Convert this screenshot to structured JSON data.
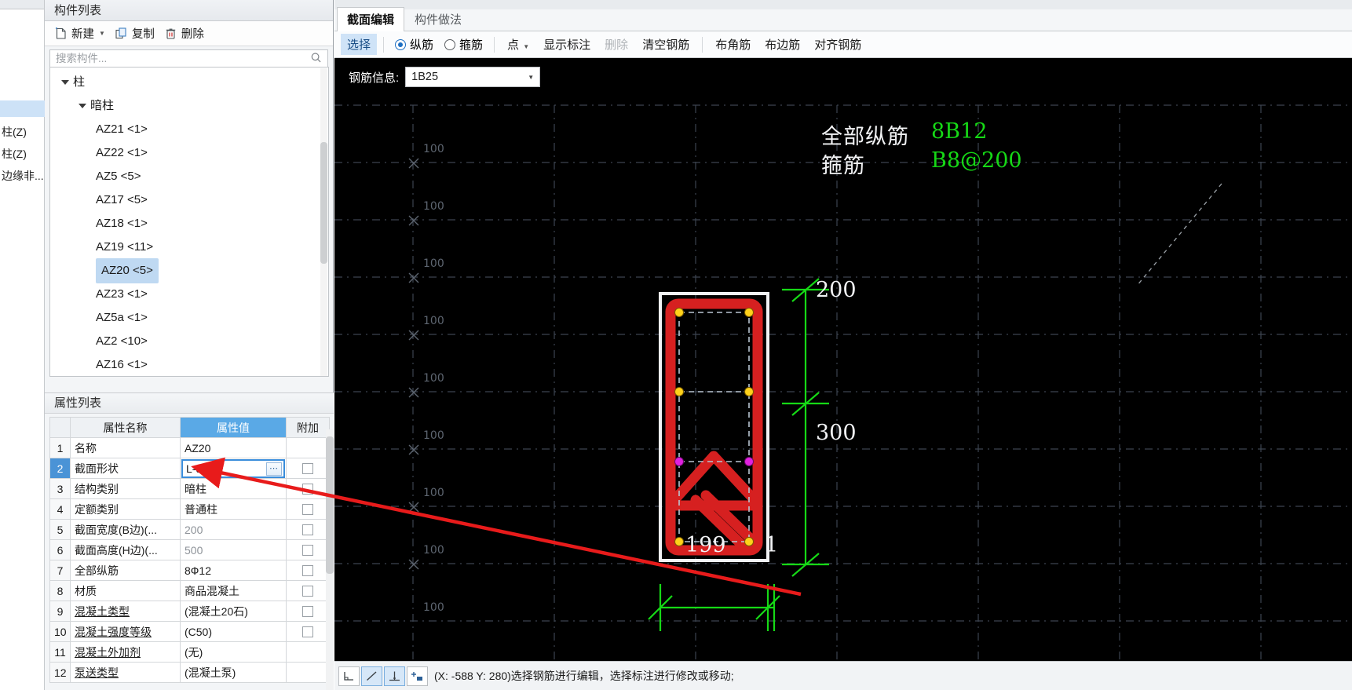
{
  "far_left": {
    "rows": [
      {
        "label": "柱(Z)"
      },
      {
        "label": "柱(Z)"
      },
      {
        "label": "边缘非..."
      }
    ]
  },
  "component_list": {
    "title": "构件列表",
    "toolbar": {
      "new_label": "新建",
      "copy_label": "复制",
      "delete_label": "删除"
    },
    "search": {
      "placeholder": "搜索构件...",
      "value": ""
    },
    "tree": [
      {
        "label": "柱",
        "level": 0,
        "expanded": true,
        "selected": false
      },
      {
        "label": "暗柱",
        "level": 1,
        "expanded": true,
        "selected": false
      },
      {
        "label": "AZ21 <1>",
        "level": 2,
        "expanded": false,
        "selected": false
      },
      {
        "label": "AZ22 <1>",
        "level": 2,
        "expanded": false,
        "selected": false
      },
      {
        "label": "AZ5 <5>",
        "level": 2,
        "expanded": false,
        "selected": false
      },
      {
        "label": "AZ17 <5>",
        "level": 2,
        "expanded": false,
        "selected": false
      },
      {
        "label": "AZ18 <1>",
        "level": 2,
        "expanded": false,
        "selected": false
      },
      {
        "label": "AZ19 <11>",
        "level": 2,
        "expanded": false,
        "selected": false
      },
      {
        "label": "AZ20 <5>",
        "level": 2,
        "expanded": false,
        "selected": true
      },
      {
        "label": "AZ23 <1>",
        "level": 2,
        "expanded": false,
        "selected": false
      },
      {
        "label": "AZ5a <1>",
        "level": 2,
        "expanded": false,
        "selected": false
      },
      {
        "label": "AZ2 <10>",
        "level": 2,
        "expanded": false,
        "selected": false
      },
      {
        "label": "AZ16 <1>",
        "level": 2,
        "expanded": false,
        "selected": false
      }
    ]
  },
  "property_list": {
    "title": "属性列表",
    "headers": {
      "index": "",
      "name": "属性名称",
      "value": "属性值",
      "extra": "附加"
    },
    "rows": [
      {
        "i": "1",
        "name": "名称",
        "value": "AZ20",
        "underline": false,
        "gray": false,
        "checkbox": false,
        "selected": false,
        "editing": false
      },
      {
        "i": "2",
        "name": "截面形状",
        "value": "L-d形",
        "underline": false,
        "gray": false,
        "checkbox": true,
        "selected": true,
        "editing": true
      },
      {
        "i": "3",
        "name": "结构类别",
        "value": "暗柱",
        "underline": false,
        "gray": false,
        "checkbox": true,
        "selected": false,
        "editing": false
      },
      {
        "i": "4",
        "name": "定额类别",
        "value": "普通柱",
        "underline": false,
        "gray": false,
        "checkbox": true,
        "selected": false,
        "editing": false
      },
      {
        "i": "5",
        "name": "截面宽度(B边)(...",
        "value": "200",
        "underline": false,
        "gray": true,
        "checkbox": true,
        "selected": false,
        "editing": false
      },
      {
        "i": "6",
        "name": "截面高度(H边)(...",
        "value": "500",
        "underline": false,
        "gray": true,
        "checkbox": true,
        "selected": false,
        "editing": false
      },
      {
        "i": "7",
        "name": "全部纵筋",
        "value": "8Ф12",
        "underline": false,
        "gray": false,
        "checkbox": true,
        "selected": false,
        "editing": false
      },
      {
        "i": "8",
        "name": "材质",
        "value": "商品混凝土",
        "underline": false,
        "gray": false,
        "checkbox": true,
        "selected": false,
        "editing": false
      },
      {
        "i": "9",
        "name": "混凝土类型",
        "value": "(混凝土20石)",
        "underline": true,
        "gray": false,
        "checkbox": true,
        "selected": false,
        "editing": false
      },
      {
        "i": "10",
        "name": "混凝土强度等级",
        "value": "(C50)",
        "underline": true,
        "gray": false,
        "checkbox": true,
        "selected": false,
        "editing": false
      },
      {
        "i": "11",
        "name": "混凝土外加剂",
        "value": "(无)",
        "underline": true,
        "gray": false,
        "checkbox": false,
        "selected": false,
        "editing": false
      },
      {
        "i": "12",
        "name": "泵送类型",
        "value": "(混凝土泵)",
        "underline": true,
        "gray": false,
        "checkbox": false,
        "selected": false,
        "editing": false
      }
    ]
  },
  "editor": {
    "tabs": [
      {
        "label": "截面编辑",
        "active": true
      },
      {
        "label": "构件做法",
        "active": false
      }
    ],
    "toolbar": {
      "select_label": "选择",
      "longitudinal_label": "纵筋",
      "longitudinal_checked": true,
      "stirrup_label": "箍筋",
      "stirrup_checked": false,
      "point_label": "点",
      "show_dim_label": "显示标注",
      "delete_label": "删除",
      "clear_rebar_label": "清空钢筋",
      "corner_rebar_label": "布角筋",
      "edge_rebar_label": "布边筋",
      "align_rebar_label": "对齐钢筋"
    },
    "rebar_info": {
      "label": "钢筋信息:",
      "value": "1B25"
    }
  },
  "drawing": {
    "ruler_left_labels": [
      "100",
      "100",
      "100",
      "100",
      "100",
      "100",
      "100",
      "100",
      "100"
    ],
    "annotations": [
      {
        "name": "全部纵筋",
        "value": "8B12"
      },
      {
        "name": "箍筋",
        "value": "B8@200"
      }
    ],
    "dimensions_vertical": [
      "200",
      "300"
    ],
    "dimensions_horizontal": [
      "199",
      "1"
    ]
  },
  "statusbar": {
    "icons": [
      "corner-snap-icon",
      "line-snap-icon",
      "perpendicular-snap-icon",
      "add-point-icon"
    ],
    "message": "(X: -588 Y: 280)选择钢筋进行编辑，选择标注进行修改或移动;"
  },
  "colors": {
    "accent": "#5aa9e6",
    "selection": "#bfd9f2",
    "rebar_red": "#d62020",
    "dim_green": "#16d916",
    "annot_green": "#16d916",
    "canvas_bg": "#000000"
  }
}
